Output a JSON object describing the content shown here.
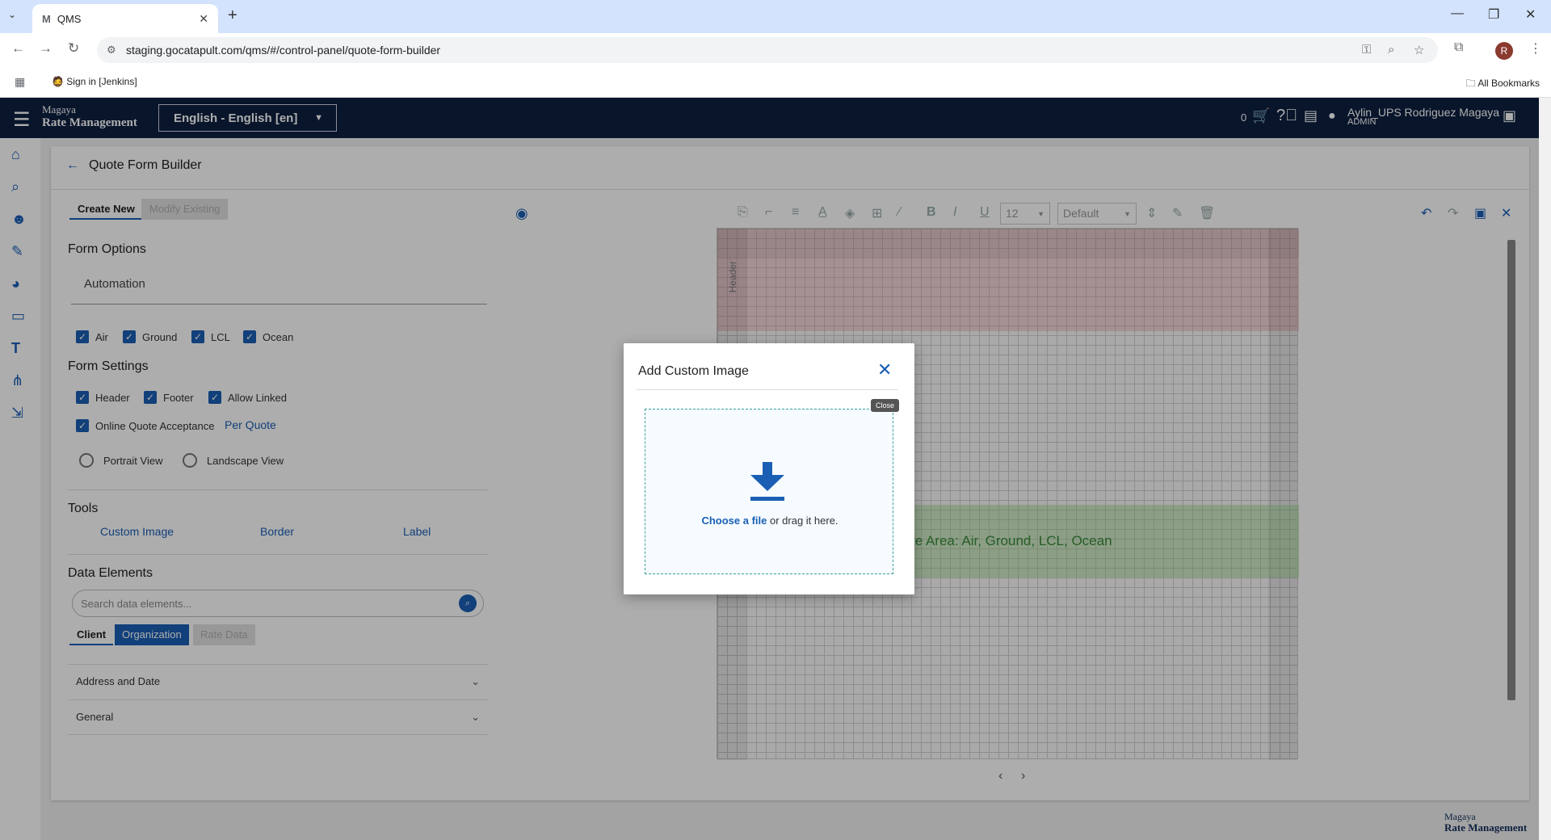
{
  "browser": {
    "tab_title": "QMS",
    "url": "staging.gocatapult.com/qms/#/control-panel/quote-form-builder",
    "bookmark_item": "Sign in [Jenkins]",
    "all_bookmarks": "All Bookmarks",
    "profile_initial": "R"
  },
  "app": {
    "brand_line1": "Magaya",
    "brand_line2": "Rate Management",
    "language": "English - English [en]",
    "cart_count": "0",
    "user_name": "Aylin_UPS Rodriguez Magaya",
    "user_role": "ADMIN"
  },
  "page": {
    "title": "Quote Form Builder",
    "tab_create": "Create New",
    "tab_modify": "Modify Existing"
  },
  "form_options": {
    "heading": "Form Options",
    "automation_value": "Automation",
    "modes": [
      "Air",
      "Ground",
      "LCL",
      "Ocean"
    ]
  },
  "form_settings": {
    "heading": "Form Settings",
    "header": "Header",
    "footer": "Footer",
    "allow_linked": "Allow Linked",
    "online_quote": "Online Quote Acceptance",
    "per_quote": "Per Quote",
    "portrait": "Portrait View",
    "landscape": "Landscape View"
  },
  "tools": {
    "heading": "Tools",
    "custom_image": "Custom Image",
    "border": "Border",
    "label": "Label"
  },
  "data_elements": {
    "heading": "Data Elements",
    "search_placeholder": "Search data elements...",
    "tab_client": "Client",
    "tab_org": "Organization",
    "tab_rate": "Rate Data",
    "sections": [
      "Address and Date",
      "General"
    ]
  },
  "toolbar": {
    "font_size": "12",
    "font_family": "Default"
  },
  "canvas": {
    "header_label": "Header",
    "rate_area_text": "te Area: Air, Ground, LCL, Ocean"
  },
  "modal": {
    "title": "Add Custom Image",
    "choose": "Choose a file",
    "drag": " or drag it here.",
    "tooltip": "Close"
  },
  "footer": {
    "brand_line1": "Magaya",
    "brand_line2": "Rate Management"
  }
}
